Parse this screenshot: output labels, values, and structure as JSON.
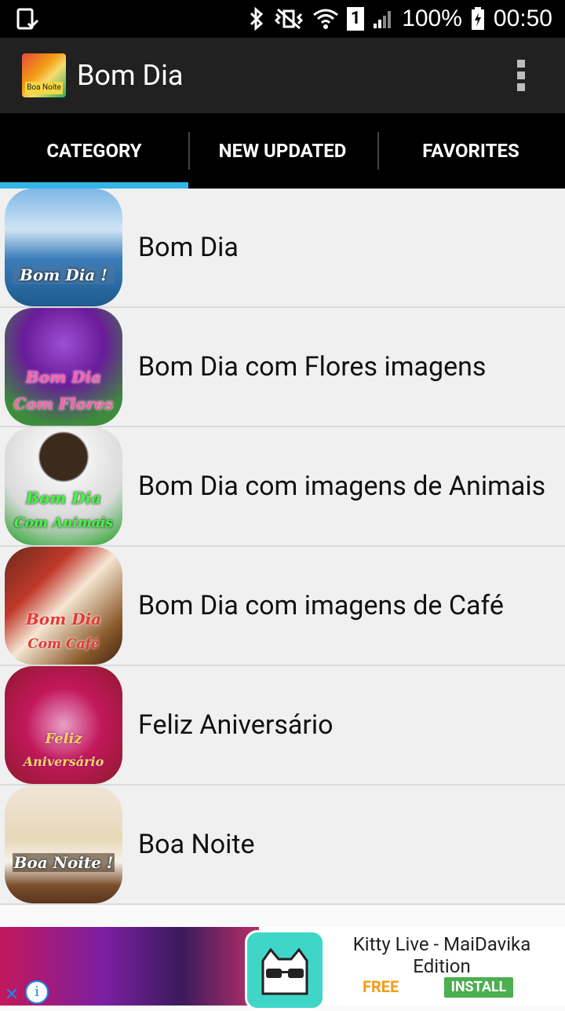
{
  "status_bar": {
    "battery": "100%",
    "time": "00:50",
    "sim": "1"
  },
  "app_bar": {
    "title": "Bom Dia",
    "icon_text": "Boa Noite"
  },
  "tabs": [
    {
      "label": "CATEGORY",
      "active": true
    },
    {
      "label": "NEW UPDATED",
      "active": false
    },
    {
      "label": "FAVORITES",
      "active": false
    }
  ],
  "categories": [
    {
      "label": "Bom Dia",
      "thumb_text": [
        "Bom Dia !"
      ]
    },
    {
      "label": "Bom Dia com Flores imagens",
      "thumb_text": [
        "Bom Dia",
        "Com Flores"
      ]
    },
    {
      "label": "Bom Dia com imagens de Animais",
      "thumb_text": [
        "Bom Dia",
        "Com Animais"
      ]
    },
    {
      "label": "Bom Dia com imagens de Café",
      "thumb_text": [
        "Bom Dia",
        "Com Café"
      ]
    },
    {
      "label": "Feliz Aniversário",
      "thumb_text": [
        "Feliz",
        "Aniversário"
      ]
    },
    {
      "label": "Boa Noite",
      "thumb_text": [
        "Boa Noite !"
      ]
    }
  ],
  "ad": {
    "title": "Kitty Live - MaiDavika Edition",
    "price": "FREE",
    "install": "INSTALL"
  },
  "colors": {
    "tab_indicator": "#33b5e5",
    "app_bar": "#212121",
    "install": "#4caf50",
    "free": "#f39c12"
  }
}
